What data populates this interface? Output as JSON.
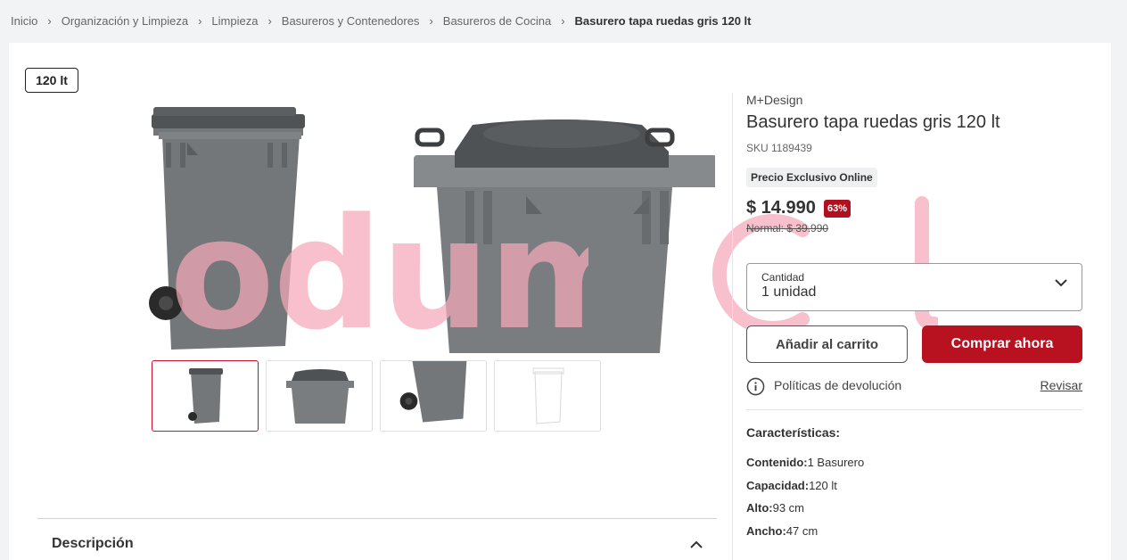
{
  "breadcrumb": {
    "items": [
      "Inicio",
      "Organización y Limpieza",
      "Limpieza",
      "Basureros y Contenedores",
      "Basureros de Cocina"
    ],
    "current": "Basurero tapa ruedas gris 120 lt"
  },
  "gallery": {
    "capacity_tag": "120 lt",
    "watermark": "odum.cl",
    "thumbnail_count": 4
  },
  "product": {
    "brand": "M+Design",
    "title": "Basurero tapa ruedas gris 120 lt",
    "sku": "SKU 1189439",
    "online_badge": "Precio Exclusivo Online",
    "price": "$ 14.990",
    "discount": "63%",
    "normal_price": "Normal: $ 39.990"
  },
  "quantity": {
    "label": "Cantidad",
    "value": "1 unidad"
  },
  "actions": {
    "add_to_cart": "Añadir al carrito",
    "buy_now": "Comprar ahora"
  },
  "returns": {
    "text": "Políticas de devolución",
    "link": "Revisar"
  },
  "features": {
    "title": "Características:",
    "items": [
      {
        "label": "Contenido:",
        "value": "1 Basurero"
      },
      {
        "label": "Capacidad:",
        "value": "120 lt"
      },
      {
        "label": "Alto:",
        "value": "93 cm"
      },
      {
        "label": "Ancho:",
        "value": "47 cm"
      }
    ]
  },
  "description": {
    "title": "Descripción"
  },
  "colors": {
    "accent": "#b8111f",
    "bin_body": "#737679",
    "bin_lid": "#4f5254",
    "watermark": "#f4a7b9"
  }
}
